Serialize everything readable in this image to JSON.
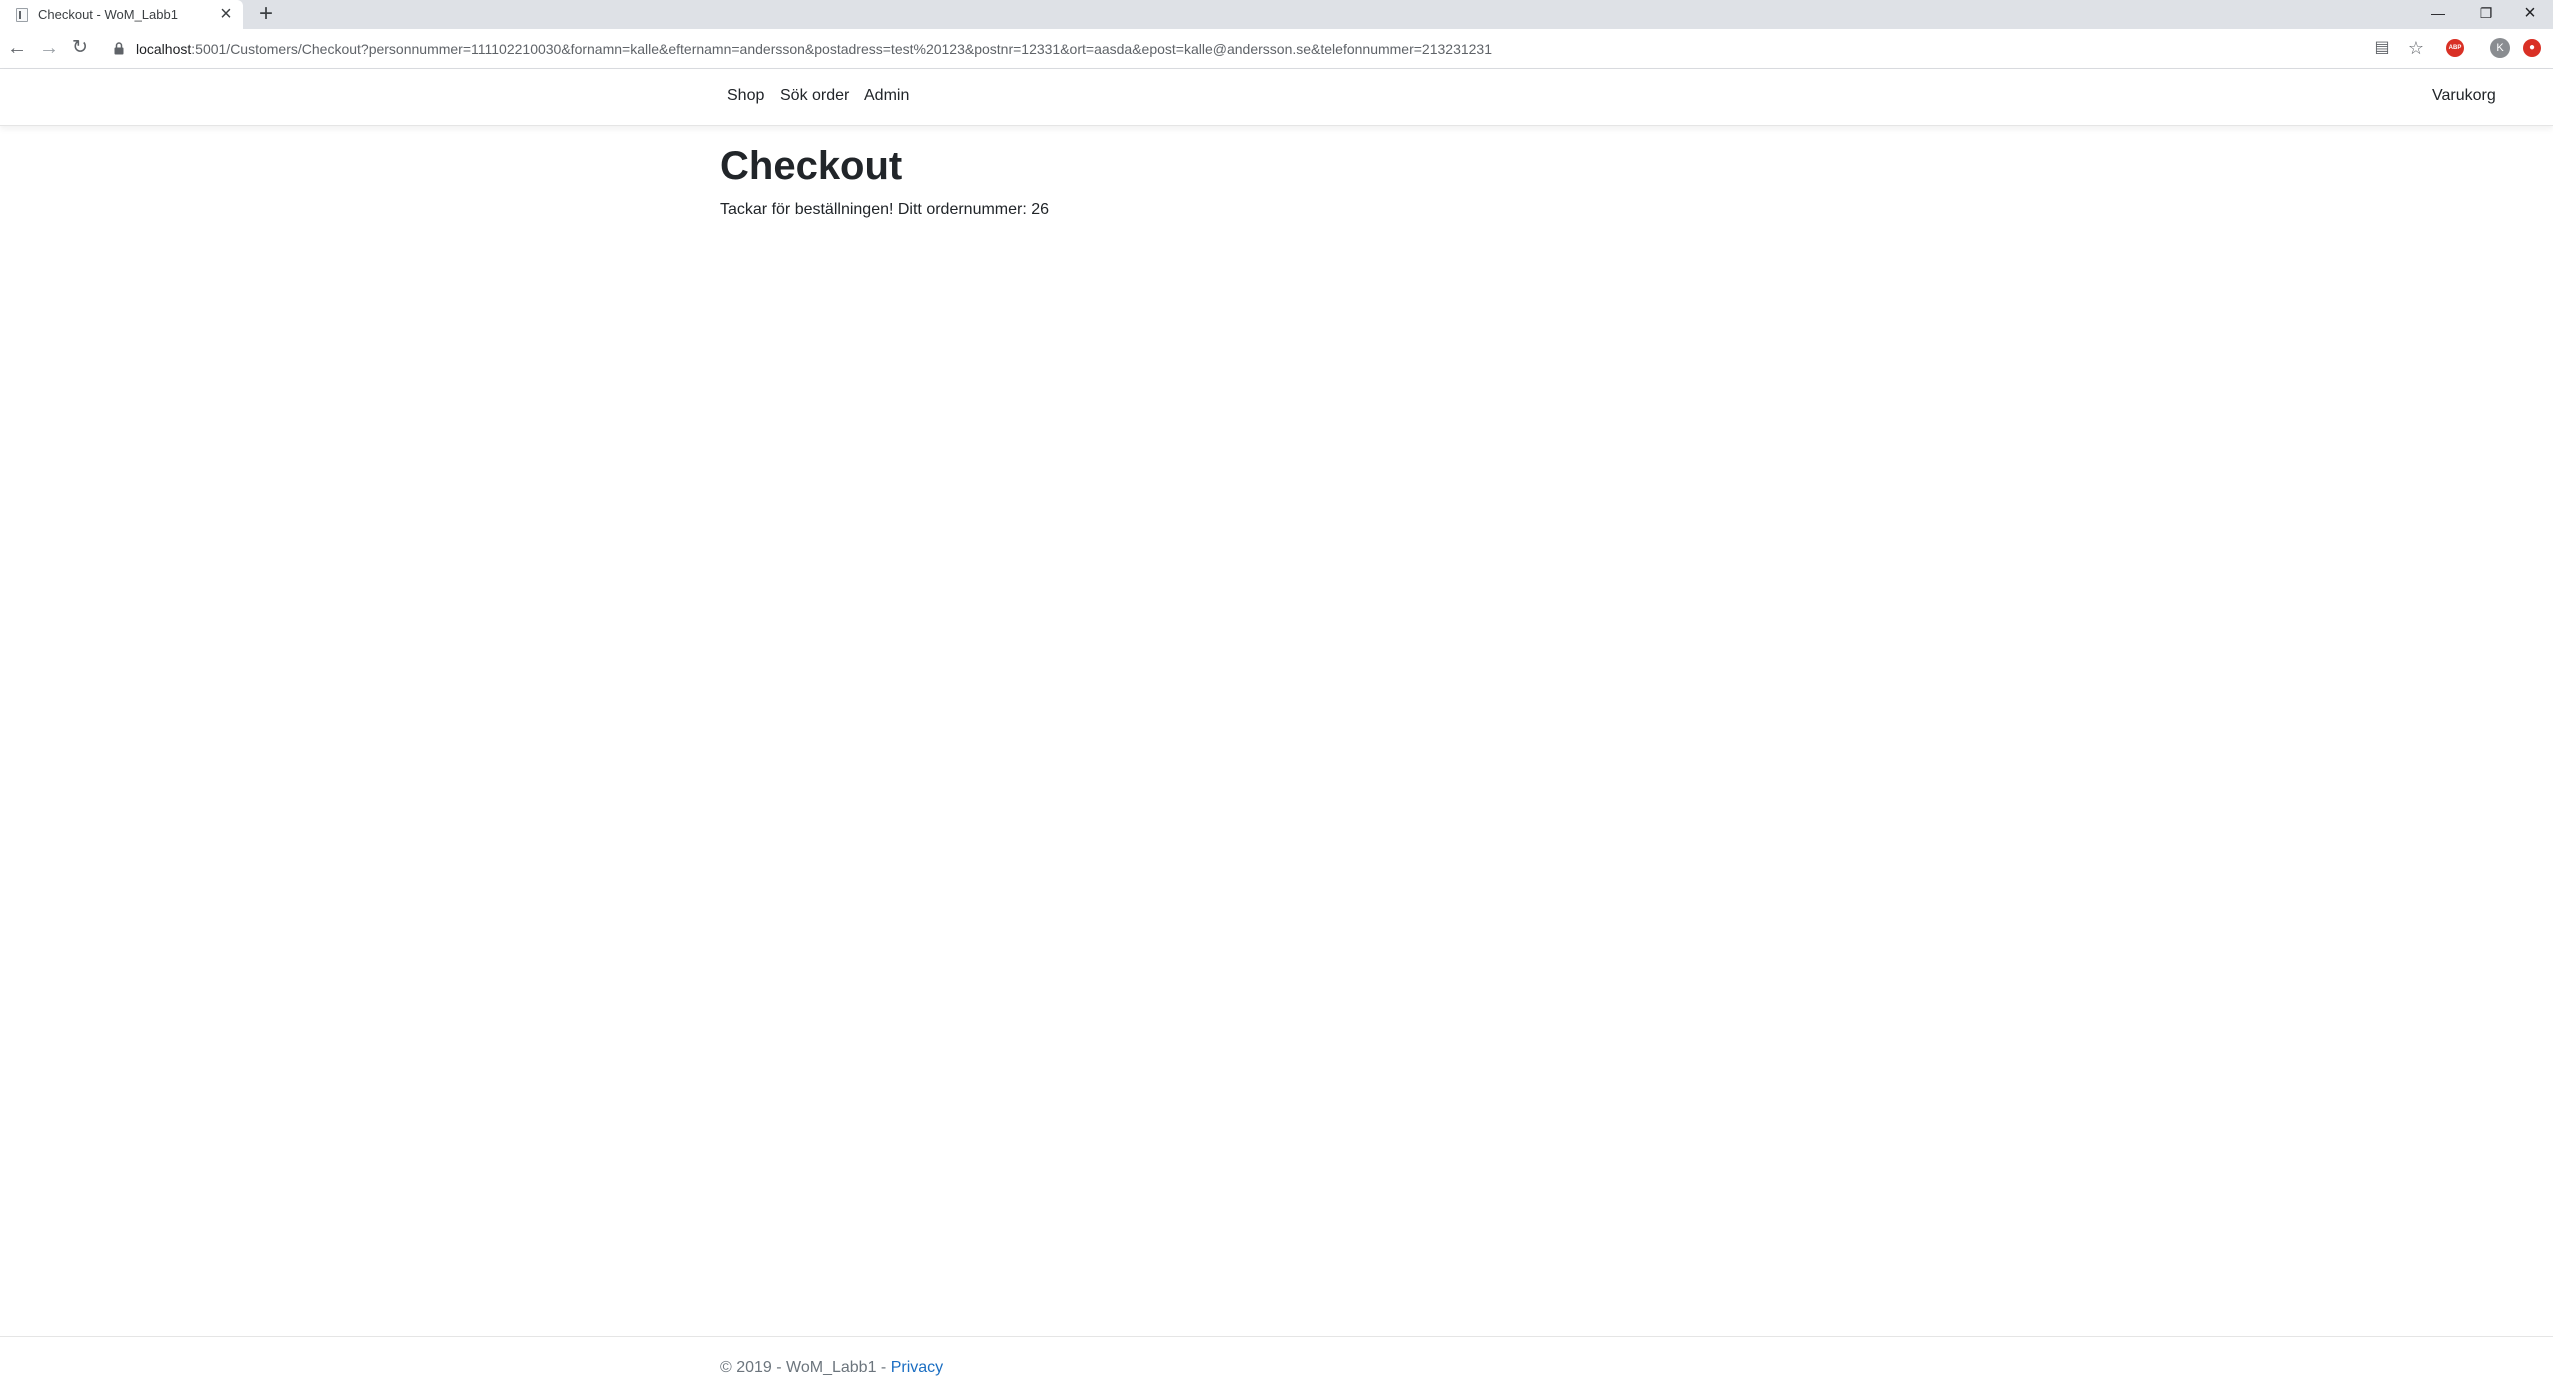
{
  "browser": {
    "tab_title": "Checkout - WoM_Labb1",
    "url_host": "localhost",
    "url_rest": ":5001/Customers/Checkout?personnummer=111102210030&fornamn=kalle&efternamn=andersson&postadress=test%20123&postnr=12331&ort=aasda&epost=kalle@andersson.se&telefonnummer=213231231",
    "new_tab_glyph": "+",
    "close_tab_glyph": "×",
    "profile_initial": "K",
    "icons": {
      "back": "arrow-left-icon",
      "forward": "arrow-right-icon",
      "reload": "reload-icon",
      "lock": "lock-icon",
      "translate": "translate-icon",
      "bookmark": "star-icon",
      "adblock": "adblock-icon",
      "profile": "profile-icon",
      "extension": "extension-icon"
    }
  },
  "navbar": {
    "links": [
      "Shop",
      "Sök order",
      "Admin"
    ],
    "cart": "Varukorg"
  },
  "main": {
    "title": "Checkout",
    "message": "Tackar för beställningen! Ditt ordernummer: 26"
  },
  "footer": {
    "text": "© 2019 - WoM_Labb1 - ",
    "privacy_link": "Privacy"
  },
  "colors": {
    "link": "#1b6ec2",
    "text": "#212529",
    "muted": "#6c757d",
    "tabstrip": "#dee1e6"
  }
}
